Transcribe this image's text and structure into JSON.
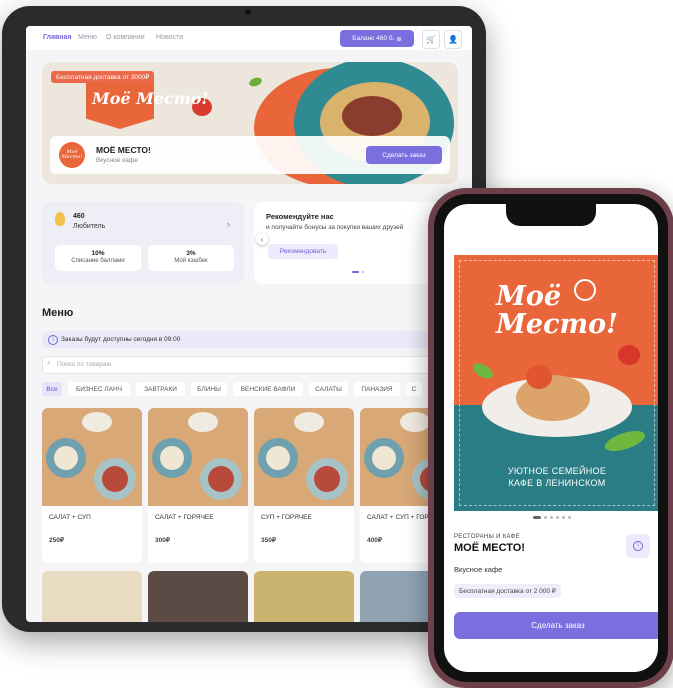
{
  "tablet": {
    "nav": [
      "Главная",
      "Меню",
      "О компании",
      "Новости"
    ],
    "balance_label": "Баланс 460 б.",
    "hero": {
      "delivery_badge": "Бесплатная доставка от 3000₽",
      "logo_text": "Моё Место!",
      "restaurant_name": "МОЁ МЕСТО!",
      "restaurant_type": "Вкусное кафе",
      "mini_logo": "Моё Место!",
      "order_button": "Сделать заказ"
    },
    "loyalty": {
      "points": "460",
      "level": "Любитель",
      "stats": [
        {
          "value": "10%",
          "label": "Списание баллами"
        },
        {
          "value": "3%",
          "label": "Мой кэшбек"
        }
      ]
    },
    "recommend": {
      "title": "Рекомендуйте нас",
      "subtitle": "и получайте бонусы за покупки ваших друзей",
      "button": "Рекомендовать"
    },
    "menu_title": "Меню",
    "info_bar": "Заказы будут доступны сегодня в 09:00",
    "search_placeholder": "Поиск по товарам",
    "categories": [
      "Все",
      "БИЗНЕС ЛАНЧ",
      "ЗАВТРАКИ",
      "БЛИНЫ",
      "ВЕНСКИЕ ВАФЛИ",
      "САЛАТЫ",
      "ПАНАЗИЯ",
      "С"
    ],
    "products": [
      {
        "name": "САЛАТ + СУП",
        "price": "250₽"
      },
      {
        "name": "САЛАТ + ГОРЯЧЕЕ",
        "price": "300₽"
      },
      {
        "name": "СУП + ГОРЯЧЕЕ",
        "price": "350₽"
      },
      {
        "name": "САЛАТ + СУП + ГОР",
        "price": "400₽"
      }
    ]
  },
  "phone": {
    "poster_logo": "Моё Место!",
    "poster_line1": "УЮТНОЕ СЕМЕЙНОЕ",
    "poster_line2": "КАФЕ В ЛЕНИНСКОМ",
    "kicker": "РЕСТОРАНЫ И КАФЕ",
    "title": "МОЁ МЕСТО!",
    "subtitle": "Вкусное кафе",
    "delivery_chip": "Бесплатная доставка от 2 000 ₽",
    "order_button": "Сделать заказ"
  },
  "colors": {
    "accent": "#7b6fe0",
    "brand_orange": "#e8663a",
    "brand_teal": "#2b7d85"
  },
  "icons": [
    "cart-icon",
    "user-icon",
    "plus-icon",
    "medal-icon",
    "chevron-right-icon",
    "chevron-left-icon",
    "info-icon",
    "search-icon"
  ]
}
